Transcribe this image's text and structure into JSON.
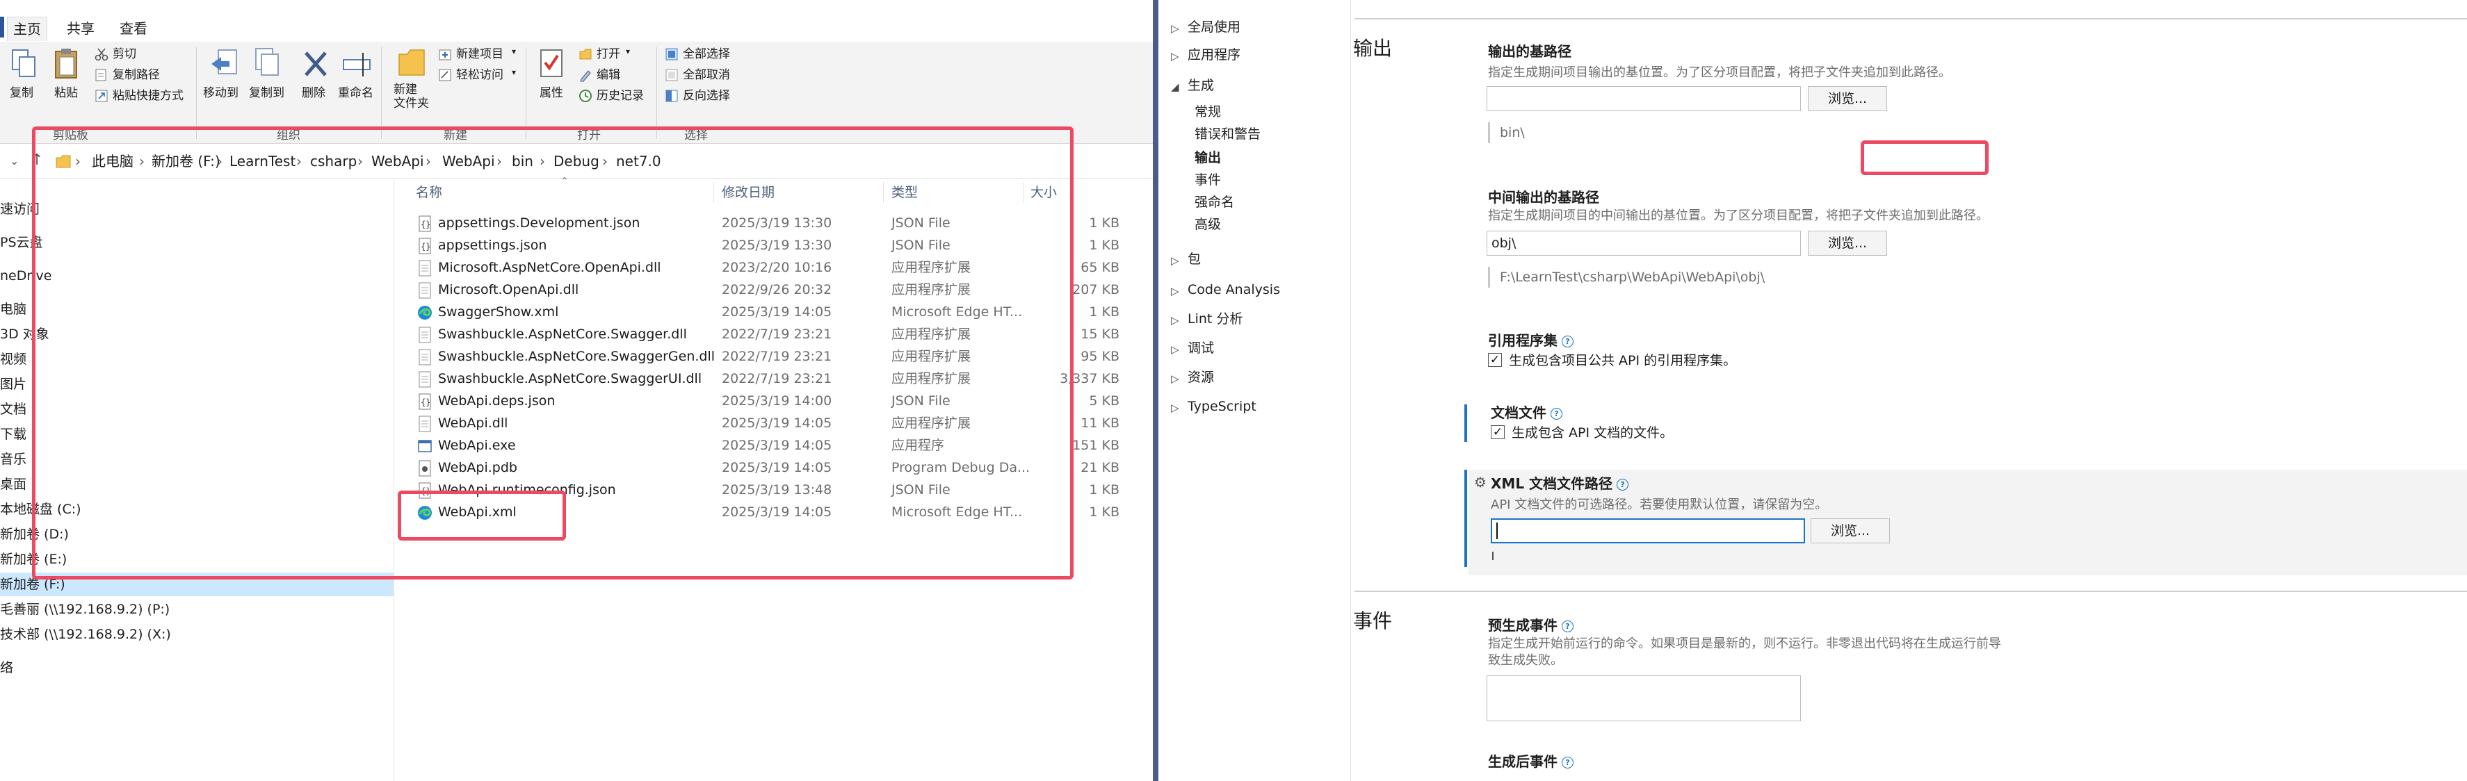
{
  "explorer": {
    "tabs": [
      "主页",
      "共享",
      "查看"
    ],
    "ribbon": {
      "copy": "复制",
      "paste": "粘贴",
      "cut": "剪切",
      "copy_path": "复制路径",
      "paste_shortcut": "粘贴快捷方式",
      "move_to": "移动到",
      "copy_to": "复制到",
      "delete": "删除",
      "rename": "重命名",
      "new_folder": "新建\n文件夹",
      "new_item": "新建项目",
      "easy_access": "轻松访问",
      "properties": "属性",
      "open": "打开",
      "edit": "编辑",
      "history": "历史记录",
      "select_all": "全部选择",
      "select_none": "全部取消",
      "invert_selection": "反向选择",
      "groups": [
        "剪贴板",
        "组织",
        "新建",
        "打开",
        "选择"
      ]
    },
    "breadcrumb": [
      "此电脑",
      "新加卷 (F:)",
      "LearnTest",
      "csharp",
      "WebApi",
      "WebApi",
      "bin",
      "Debug",
      "net7.0"
    ],
    "columns": {
      "name": "名称",
      "date": "修改日期",
      "type": "类型",
      "size": "大小"
    },
    "nav": [
      "速访问",
      "PS云盘",
      "neDrive",
      "电脑",
      "3D 对象",
      "视频",
      "图片",
      "文档",
      "下载",
      "音乐",
      "桌面",
      "本地磁盘 (C:)",
      "新加卷 (D:)",
      "新加卷 (E:)",
      "新加卷 (F:)",
      "毛善丽 (\\\\192.168.9.2) (P:)",
      "技术部 (\\\\192.168.9.2) (X:)",
      "络"
    ],
    "files": [
      {
        "name": "appsettings.Development.json",
        "date": "2025/3/19 13:30",
        "type": "JSON File",
        "size": "1 KB",
        "icon": "json-file-icon"
      },
      {
        "name": "appsettings.json",
        "date": "2025/3/19 13:30",
        "type": "JSON File",
        "size": "1 KB",
        "icon": "json-file-icon"
      },
      {
        "name": "Microsoft.AspNetCore.OpenApi.dll",
        "date": "2023/2/20 10:16",
        "type": "应用程序扩展",
        "size": "65 KB",
        "icon": "dll-file-icon"
      },
      {
        "name": "Microsoft.OpenApi.dll",
        "date": "2022/9/26 20:32",
        "type": "应用程序扩展",
        "size": "207 KB",
        "icon": "dll-file-icon"
      },
      {
        "name": "SwaggerShow.xml",
        "date": "2025/3/19 14:05",
        "type": "Microsoft Edge HT...",
        "size": "1 KB",
        "icon": "edge-file-icon"
      },
      {
        "name": "Swashbuckle.AspNetCore.Swagger.dll",
        "date": "2022/7/19 23:21",
        "type": "应用程序扩展",
        "size": "15 KB",
        "icon": "dll-file-icon"
      },
      {
        "name": "Swashbuckle.AspNetCore.SwaggerGen.dll",
        "date": "2022/7/19 23:21",
        "type": "应用程序扩展",
        "size": "95 KB",
        "icon": "dll-file-icon"
      },
      {
        "name": "Swashbuckle.AspNetCore.SwaggerUI.dll",
        "date": "2022/7/19 23:21",
        "type": "应用程序扩展",
        "size": "3,337 KB",
        "icon": "dll-file-icon"
      },
      {
        "name": "WebApi.deps.json",
        "date": "2025/3/19 14:00",
        "type": "JSON File",
        "size": "5 KB",
        "icon": "json-file-icon"
      },
      {
        "name": "WebApi.dll",
        "date": "2025/3/19 14:05",
        "type": "应用程序扩展",
        "size": "11 KB",
        "icon": "dll-file-icon"
      },
      {
        "name": "WebApi.exe",
        "date": "2025/3/19 14:05",
        "type": "应用程序",
        "size": "151 KB",
        "icon": "exe-file-icon"
      },
      {
        "name": "WebApi.pdb",
        "date": "2025/3/19 14:05",
        "type": "Program Debug Da...",
        "size": "21 KB",
        "icon": "pdb-file-icon"
      },
      {
        "name": "WebApi.runtimeconfig.json",
        "date": "2025/3/19 13:48",
        "type": "JSON File",
        "size": "1 KB",
        "icon": "json-file-icon"
      },
      {
        "name": "WebApi.xml",
        "date": "2025/3/19 14:05",
        "type": "Microsoft Edge HT...",
        "size": "1 KB",
        "icon": "edge-file-icon"
      }
    ]
  },
  "props": {
    "tree": [
      "全局使用",
      "应用程序",
      "生成",
      "常规",
      "错误和警告",
      "输出",
      "事件",
      "强命名",
      "高级",
      "包",
      "Code Analysis",
      "Lint 分析",
      "调试",
      "资源",
      "TypeScript"
    ],
    "output_section": "输出",
    "base_output": {
      "label": "输出的基路径",
      "desc": "指定生成期间项目输出的基位置。为了区分项目配置，将把子文件夹追加到此路径。",
      "value": "",
      "browse": "浏览...",
      "note": "bin\\"
    },
    "intermediate": {
      "label": "中间输出的基路径",
      "desc": "指定生成期间项目的中间输出的基位置。为了区分项目配置，将把子文件夹追加到此路径。",
      "value": "obj\\",
      "browse": "浏览...",
      "note": "F:\\LearnTest\\csharp\\WebApi\\WebApi\\obj\\"
    },
    "ref_assembly": {
      "label": "引用程序集",
      "check": "生成包含项目公共 API 的引用程序集。",
      "checked": "✓"
    },
    "doc_file": {
      "label": "文档文件",
      "check": "生成包含 API 文档的文件。",
      "checked": "✓"
    },
    "xml_path": {
      "label": "XML 文档文件路径",
      "desc": "API 文档文件的可选路径。若要使用默认位置，请保留为空。",
      "value": "",
      "browse": "浏览..."
    },
    "events_section": "事件",
    "prebuild": {
      "label": "预生成事件",
      "desc1": "指定生成开始前运行的命令。如果项目是最新的，则不运行。非零退出代码将在生成运行前导",
      "desc2": "致生成失败。"
    },
    "postbuild": {
      "label": "生成后事件"
    }
  },
  "colors": {
    "highlight": "#ec4a62",
    "selection": "#cce8ff",
    "divider": "#4a5b8c",
    "accent": "#1a73c8"
  }
}
